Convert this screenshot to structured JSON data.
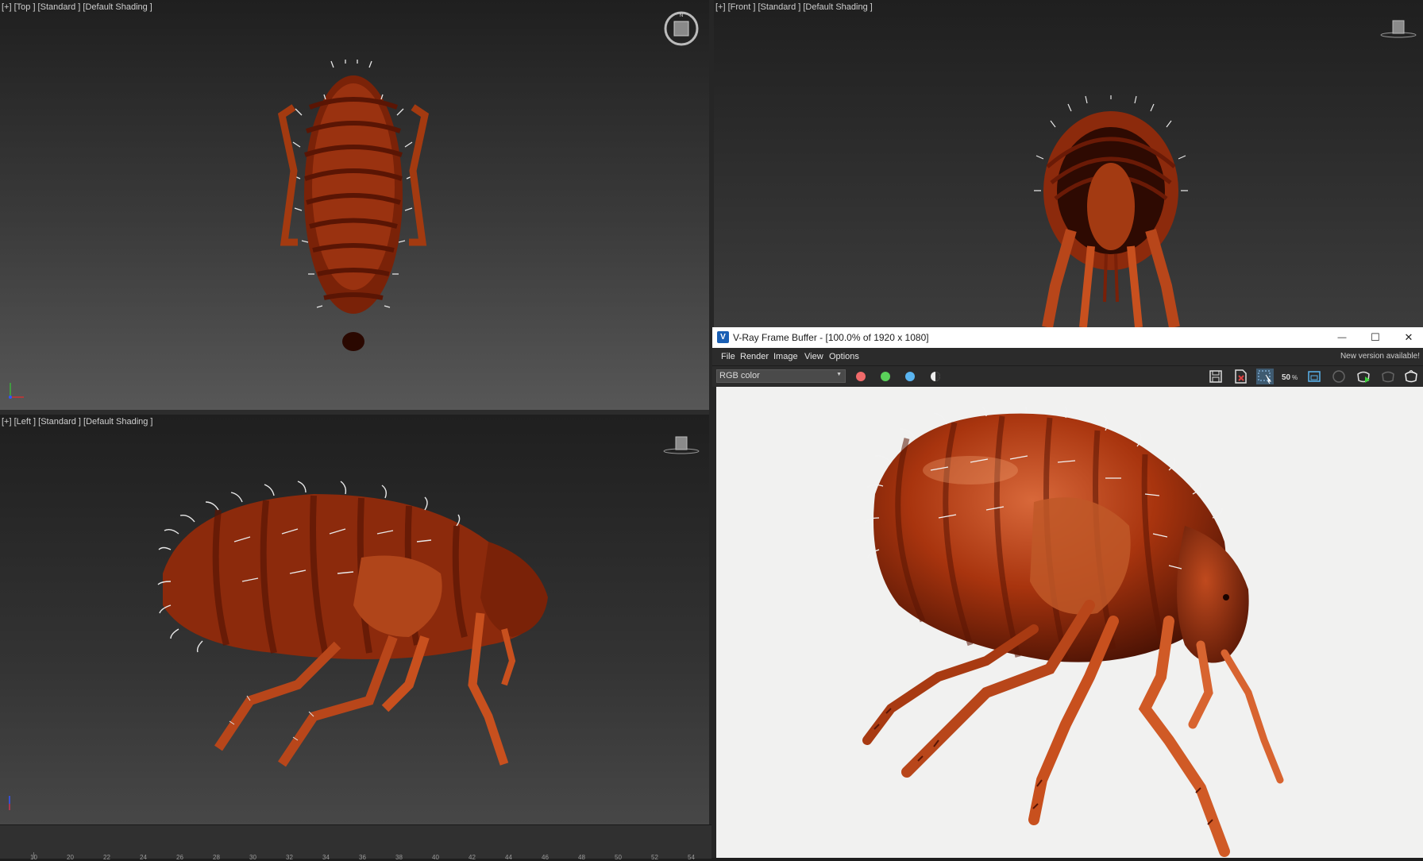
{
  "viewports": {
    "top": {
      "label": "[+] [Top ] [Standard ] [Default Shading ]"
    },
    "front": {
      "label": "[+] [Front ] [Standard ] [Default Shading ]"
    },
    "left": {
      "label": "[+] [Left ] [Standard ] [Default Shading ]"
    }
  },
  "timeline": {
    "ticks": [
      "10",
      "20",
      "22",
      "24",
      "26",
      "28",
      "30",
      "32",
      "34",
      "36",
      "38",
      "40",
      "42",
      "44",
      "46",
      "48",
      "50",
      "52",
      "54"
    ]
  },
  "vfb": {
    "title": "V-Ray Frame Buffer - [100.0% of 1920 x 1080]",
    "logo": "V",
    "window_buttons": {
      "minimize": "—",
      "maximize": "☐",
      "close": "✕"
    },
    "menu": [
      "File",
      "Render",
      "Image",
      "View",
      "Options"
    ],
    "notice": "New version available!",
    "channel": "RGB color",
    "zoom_label": "50",
    "icons": [
      "save-icon",
      "clear-image-icon",
      "region-render-icon",
      "zoom-icon",
      "lens-effects-icon",
      "render-last-icon",
      "interactive-render-icon",
      "stop-render-icon",
      "render-icon"
    ]
  },
  "colors": {
    "red_channel": "#f06a6a",
    "green_channel": "#5ad05a",
    "blue_channel": "#5ab4f0",
    "flea_dark": "#4a1204",
    "flea_mid": "#8c2a0c",
    "flea_light": "#c8501e"
  }
}
